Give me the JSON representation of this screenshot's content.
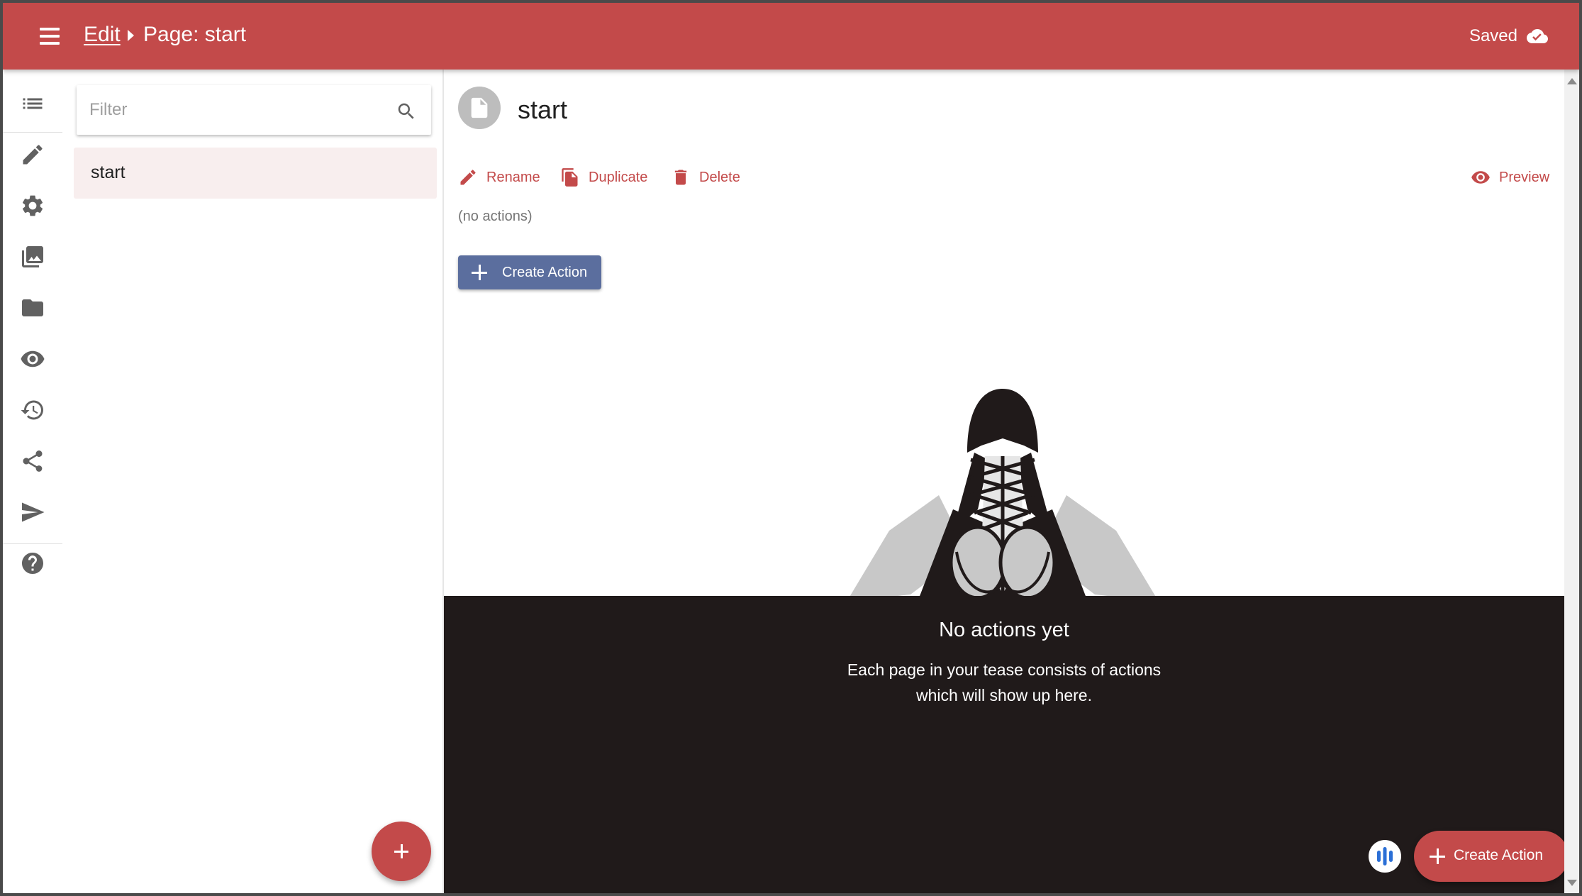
{
  "header": {
    "breadcrumb_edit": "Edit",
    "breadcrumb_page": "Page: start",
    "status": "Saved",
    "bg_color": "#c34a4a"
  },
  "rail": {
    "items": [
      {
        "name": "list-icon"
      },
      {
        "name": "pencil-icon"
      },
      {
        "name": "gear-icon"
      },
      {
        "name": "image-library-icon"
      },
      {
        "name": "folder-icon"
      },
      {
        "name": "eye-icon"
      },
      {
        "name": "history-icon"
      },
      {
        "name": "share-icon"
      },
      {
        "name": "send-icon"
      },
      {
        "name": "help-icon"
      }
    ]
  },
  "page_list": {
    "filter_placeholder": "Filter",
    "filter_value": "",
    "items": [
      {
        "label": "start",
        "selected": true
      }
    ]
  },
  "main": {
    "page_title": "start",
    "actions": {
      "rename": "Rename",
      "duplicate": "Duplicate",
      "delete": "Delete",
      "preview": "Preview"
    },
    "no_actions_text": "(no actions)",
    "create_action_label": "Create Action",
    "empty_state": {
      "title": "No actions yet",
      "description": "Each page in your tease consists of actions which will show up here."
    },
    "fab_create_label": "Create Action",
    "accent_color": "#c34a4a",
    "button_color": "#5b6e9e"
  }
}
